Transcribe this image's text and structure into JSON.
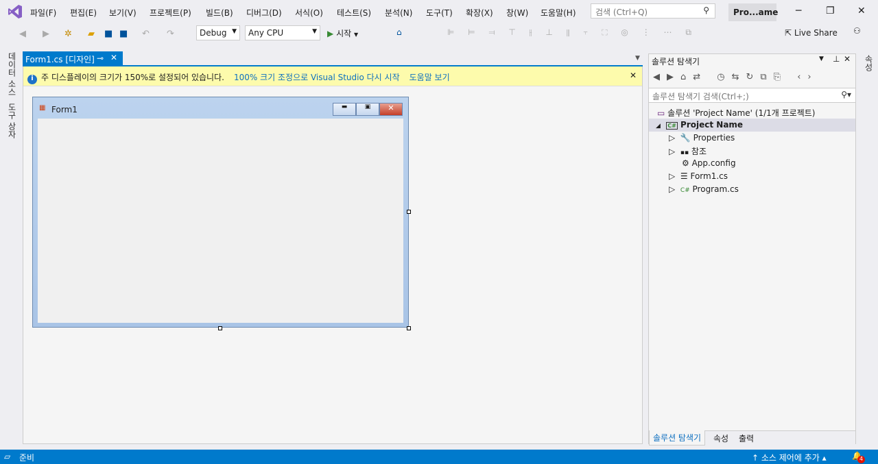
{
  "menu": [
    "파일(F)",
    "편집(E)",
    "보기(V)",
    "프로젝트(P)",
    "빌드(B)",
    "디버그(D)",
    "서식(O)",
    "테스트(S)",
    "분석(N)",
    "도구(T)",
    "확장(X)",
    "창(W)",
    "도움말(H)"
  ],
  "search_placeholder": "검색 (Ctrl+Q)",
  "project_short": "Pro...ame",
  "toolbar": {
    "config": "Debug",
    "platform": "Any CPU",
    "start": "시작",
    "live_share": "Live Share"
  },
  "left_rail": [
    "데이터 소스",
    "도구 상자"
  ],
  "right_rail": "속성",
  "tab": {
    "label": "Form1.cs [디자인]"
  },
  "info": {
    "message": "주 디스플레이의 크기가 150%로 설정되어 있습니다.",
    "link1": "100% 크기 조정으로 Visual Studio 다시 시작",
    "link2": "도움말 보기"
  },
  "form": {
    "title": "Form1"
  },
  "solution_explorer": {
    "title": "솔루션 탐색기",
    "search_placeholder": "솔루션 탐색기 검색(Ctrl+;)",
    "items": [
      {
        "label": "솔루션 'Project Name' (1/1개 프로젝트)",
        "icon": "solution-icon"
      },
      {
        "label": "Project Name",
        "icon": "csharp-project-icon"
      },
      {
        "label": "Properties",
        "icon": "wrench-icon"
      },
      {
        "label": "참조",
        "icon": "references-icon"
      },
      {
        "label": "App.config",
        "icon": "config-icon"
      },
      {
        "label": "Form1.cs",
        "icon": "form-icon"
      },
      {
        "label": "Program.cs",
        "icon": "csharp-file-icon"
      }
    ],
    "tabs": [
      "솔루션 탐색기",
      "속성",
      "출력"
    ]
  },
  "status": {
    "ready": "준비",
    "source_control": "소스 제어에 추가",
    "notifications": "4"
  },
  "colors": {
    "accent": "#007acc",
    "info_bar": "#fdfbac",
    "vs_purple": "#68217a"
  }
}
